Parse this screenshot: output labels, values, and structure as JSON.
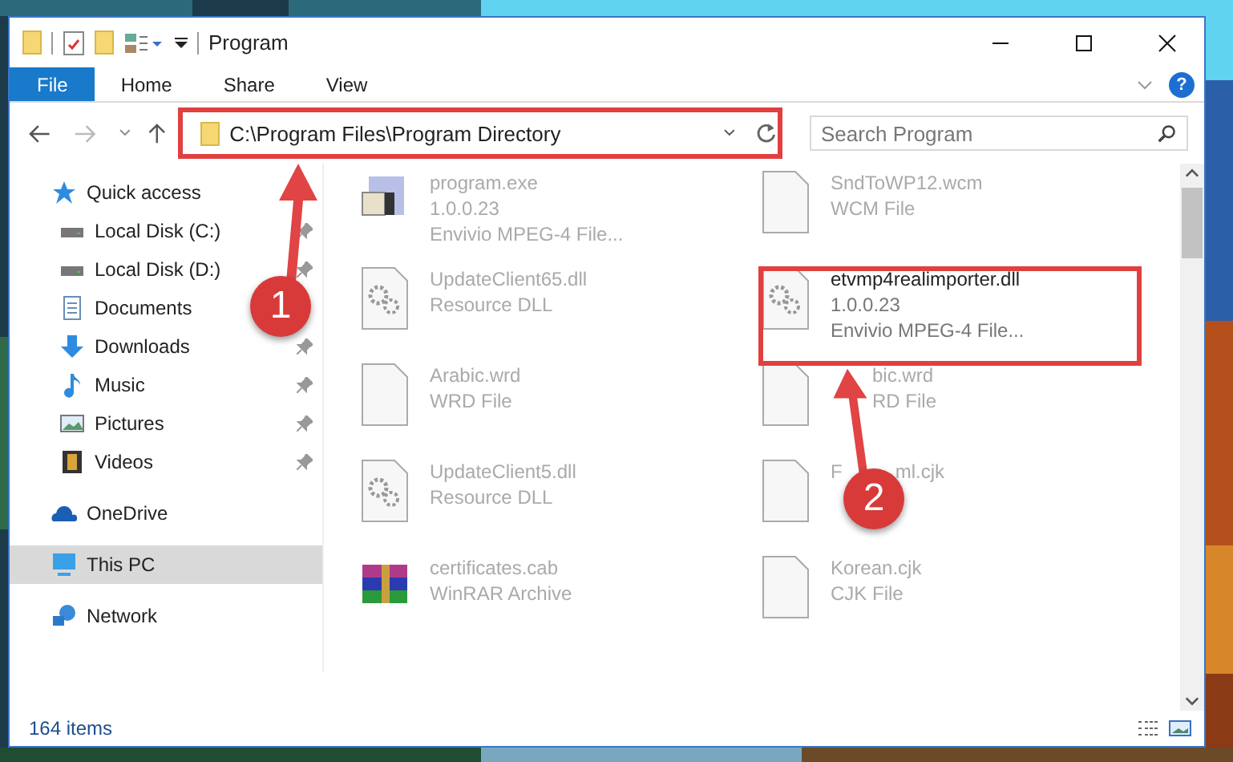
{
  "window": {
    "title": "Program"
  },
  "ribbon_tabs": [
    {
      "label": "File",
      "selected": true
    },
    {
      "label": "Home",
      "selected": false
    },
    {
      "label": "Share",
      "selected": false
    },
    {
      "label": "View",
      "selected": false
    }
  ],
  "help": "?",
  "address": {
    "path": "C:\\Program Files\\Program Directory"
  },
  "search": {
    "placeholder": "Search Program"
  },
  "nav": [
    {
      "label": "Quick access",
      "kind": "star",
      "selected": false,
      "children": [
        {
          "label": "Local Disk (C:)",
          "kind": "drive",
          "pinned": true,
          "selected": false
        },
        {
          "label": "Local Disk (D:)",
          "kind": "drive",
          "pinned": true,
          "selected": false
        },
        {
          "label": "Documents",
          "kind": "document",
          "pinned": false,
          "selected": false
        },
        {
          "label": "Downloads",
          "kind": "download",
          "pinned": true,
          "selected": false
        },
        {
          "label": "Music",
          "kind": "music",
          "pinned": true,
          "selected": false
        },
        {
          "label": "Pictures",
          "kind": "pictures",
          "pinned": true,
          "selected": false
        },
        {
          "label": "Videos",
          "kind": "videos",
          "pinned": true,
          "selected": false
        }
      ]
    },
    {
      "label": "OneDrive",
      "kind": "cloud",
      "selected": false
    },
    {
      "label": "This PC",
      "kind": "pc",
      "selected": true
    },
    {
      "label": "Network",
      "kind": "network",
      "selected": false
    }
  ],
  "files": [
    {
      "name": "program.exe",
      "details": [
        "1.0.0.23",
        "Envivio MPEG-4 File..."
      ],
      "kind": "exe",
      "faded": true
    },
    {
      "name": "SndToWP12.wcm",
      "details": [
        "WCM File"
      ],
      "kind": "blank",
      "faded": true
    },
    {
      "name": "UpdateClient65.dll",
      "details": [
        "Resource DLL"
      ],
      "kind": "dll",
      "faded": true
    },
    {
      "name": "etvmp4realimporter.dll",
      "details": [
        "1.0.0.23",
        "Envivio MPEG-4 File..."
      ],
      "kind": "dll",
      "faded": false
    },
    {
      "name": "Arabic.wrd",
      "details": [
        "WRD File"
      ],
      "kind": "blank",
      "faded": true
    },
    {
      "name": "bic.wrd",
      "details": [
        "RD File"
      ],
      "kind": "blank",
      "faded": true,
      "covered": true
    },
    {
      "name": "UpdateClient5.dll",
      "details": [
        "Resource DLL"
      ],
      "kind": "dll",
      "faded": true
    },
    {
      "name": "F",
      "name_rest": "ml.cjk",
      "kind": "blank",
      "faded": true
    },
    {
      "name": "certificates.cab",
      "details": [
        "WinRAR Archive"
      ],
      "kind": "cab",
      "faded": true
    },
    {
      "name": "Korean.cjk",
      "details": [
        "CJK File"
      ],
      "kind": "blank",
      "faded": true
    }
  ],
  "status_bar": {
    "count": "164 items"
  },
  "callouts": [
    {
      "number": "1"
    },
    {
      "number": "2"
    }
  ]
}
